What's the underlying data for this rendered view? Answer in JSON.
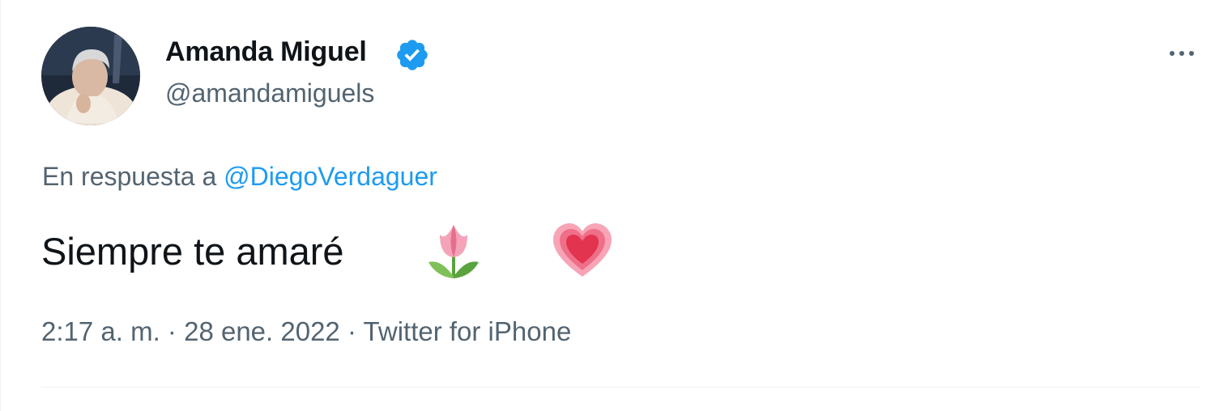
{
  "author": {
    "display_name": "Amanda Miguel",
    "handle": "@amandamiguels",
    "avatar_icon": "avatar-photo",
    "verified_icon": "verified-badge-icon",
    "verified_color": "#1d9bf0"
  },
  "reply": {
    "prefix": "En respuesta a",
    "mention": "@DiegoVerdaguer"
  },
  "tweet": {
    "text": "Siempre te amaré",
    "emojis": [
      "tulip-icon",
      "heart-icon"
    ]
  },
  "meta": {
    "time": "2:17 a. m.",
    "separator": "·",
    "date": "28 ene. 2022",
    "source": "Twitter for iPhone"
  },
  "colors": {
    "text_primary": "#0f1419",
    "text_secondary": "#536471",
    "accent": "#1d9bf0"
  }
}
